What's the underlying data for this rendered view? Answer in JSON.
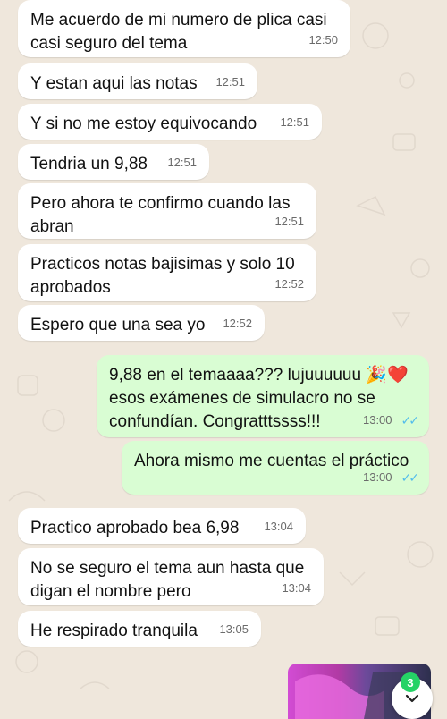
{
  "colors": {
    "background": "#efe7dc",
    "incoming_bubble": "#ffffff",
    "outgoing_bubble": "#d9fdd3",
    "read_ticks": "#53bdeb",
    "badge": "#25d366"
  },
  "messages": [
    {
      "text": "Me acuerdo de mi numero de plica casi\ncasi seguro del tema",
      "time": "12:50"
    },
    {
      "text": "Y estan aqui las notas",
      "time": "12:51"
    },
    {
      "text": "Y si no me estoy equivocando",
      "time": "12:51"
    },
    {
      "text": "Tendria un 9,88",
      "time": "12:51"
    },
    {
      "text": "Pero ahora te confirmo cuando las\nabran",
      "time": "12:51"
    },
    {
      "text": "Practicos notas bajisimas y solo 10\naprobados",
      "time": "12:52"
    },
    {
      "text": "Espero que una sea yo",
      "time": "12:52"
    },
    {
      "text": "9,88 en el temaaaa??? lujuuuuuu 🎉❤️\nesos exámenes de simulacro no se\nconfundían. Congratttssss!!!",
      "time": "13:00",
      "ticks": "✓✓"
    },
    {
      "text": "Ahora mismo me cuentas el práctico",
      "time": "13:00",
      "ticks": "✓✓"
    },
    {
      "text": "Practico aprobado bea 6,98",
      "time": "13:04"
    },
    {
      "text": "No se seguro el tema aun hasta que\ndigan el nombre pero",
      "time": "13:04"
    },
    {
      "text": "He respirado tranquila",
      "time": "13:05"
    }
  ],
  "scroll_button": {
    "icon": "chevron-down-icon",
    "badge_count": "3"
  }
}
